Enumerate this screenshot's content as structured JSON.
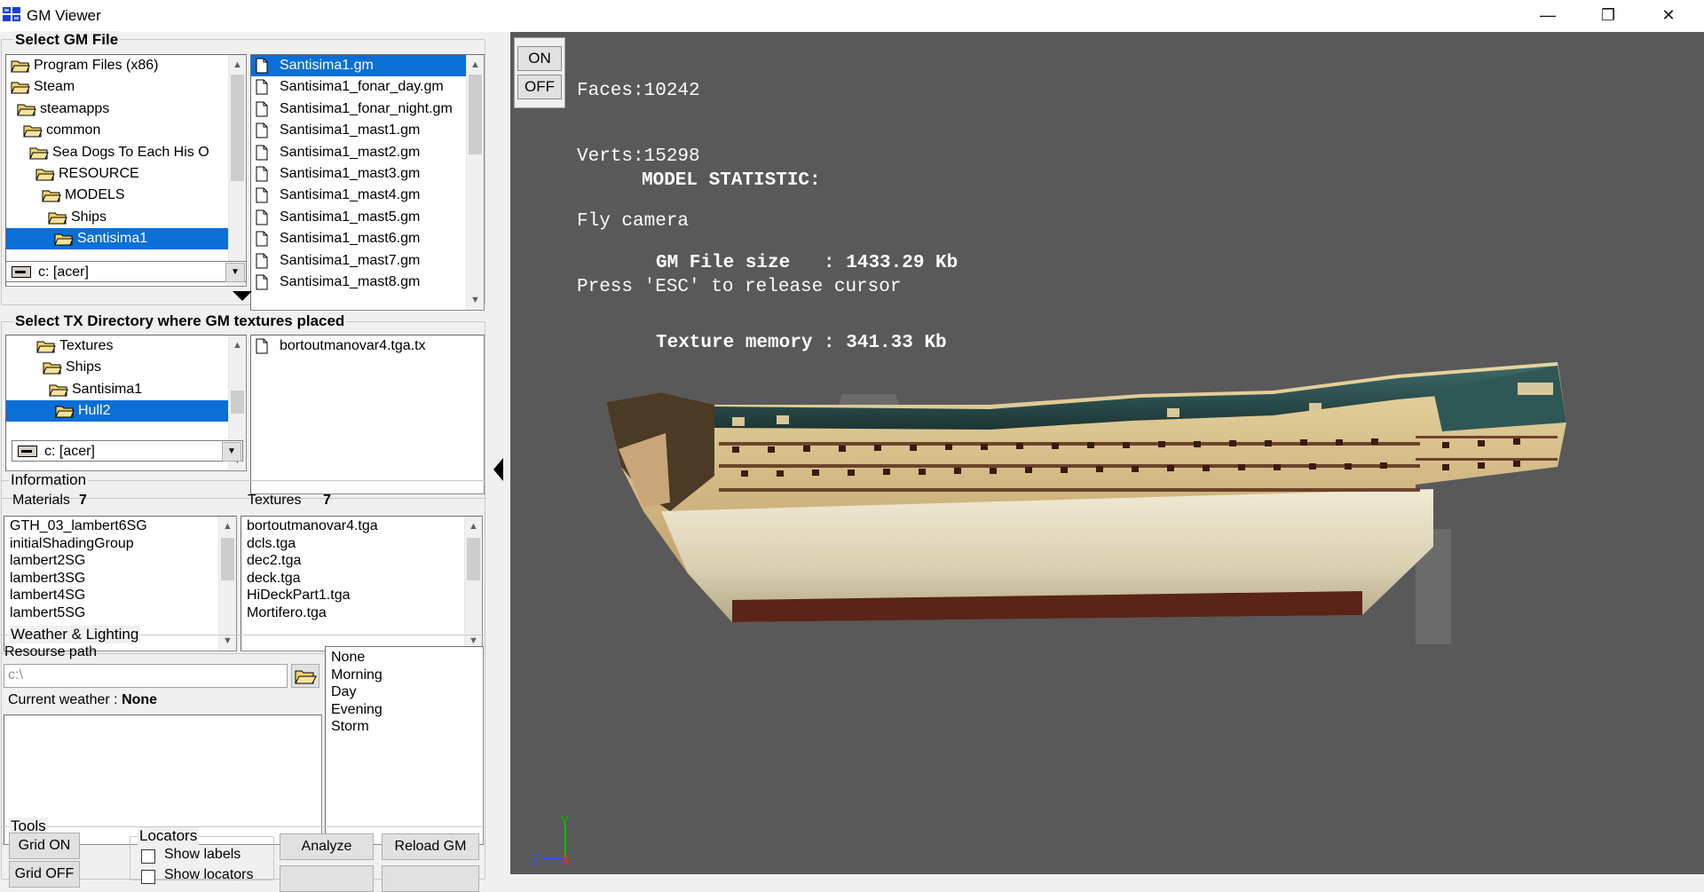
{
  "window": {
    "title": "GM Viewer",
    "buttons": [
      "—",
      "❐",
      "✕"
    ]
  },
  "gm_file": {
    "title": "Select GM File",
    "folders": [
      {
        "label": "Program Files (x86)",
        "depth": 0,
        "selected": false
      },
      {
        "label": "Steam",
        "depth": 0,
        "selected": false
      },
      {
        "label": "steamapps",
        "depth": 1,
        "selected": false
      },
      {
        "label": "common",
        "depth": 2,
        "selected": false
      },
      {
        "label": "Sea Dogs To Each His O",
        "depth": 3,
        "selected": false
      },
      {
        "label": "RESOURCE",
        "depth": 4,
        "selected": false
      },
      {
        "label": "MODELS",
        "depth": 5,
        "selected": false
      },
      {
        "label": "Ships",
        "depth": 6,
        "selected": false
      },
      {
        "label": "Santisima1",
        "depth": 7,
        "selected": true
      }
    ],
    "drive": "c: [acer]",
    "files": [
      {
        "label": "Santisima1.gm",
        "selected": true
      },
      {
        "label": "Santisima1_fonar_day.gm",
        "selected": false
      },
      {
        "label": "Santisima1_fonar_night.gm",
        "selected": false
      },
      {
        "label": "Santisima1_mast1.gm",
        "selected": false
      },
      {
        "label": "Santisima1_mast2.gm",
        "selected": false
      },
      {
        "label": "Santisima1_mast3.gm",
        "selected": false
      },
      {
        "label": "Santisima1_mast4.gm",
        "selected": false
      },
      {
        "label": "Santisima1_mast5.gm",
        "selected": false
      },
      {
        "label": "Santisima1_mast6.gm",
        "selected": false
      },
      {
        "label": "Santisima1_mast7.gm",
        "selected": false
      },
      {
        "label": "Santisima1_mast8.gm",
        "selected": false
      }
    ]
  },
  "tx_dir": {
    "title": "Select TX Directory where GM textures placed",
    "folders": [
      {
        "label": "Textures",
        "depth": 0,
        "selected": false
      },
      {
        "label": "Ships",
        "depth": 1,
        "selected": false
      },
      {
        "label": "Santisima1",
        "depth": 2,
        "selected": false
      },
      {
        "label": "Hull2",
        "depth": 3,
        "selected": true
      }
    ],
    "drive": "c: [acer]",
    "files": [
      "bortoutmanovar4.tga.tx"
    ]
  },
  "info": {
    "title": "Information",
    "materials_label": "Materials",
    "materials_count": "7",
    "textures_label": "Textures",
    "textures_count": "7",
    "materials": [
      "GTH_03_lambert6SG",
      "initialShadingGroup",
      "lambert2SG",
      "lambert3SG",
      "lambert4SG",
      "lambert5SG"
    ],
    "textures": [
      "bortoutmanovar4.tga",
      "dcls.tga",
      "dec2.tga",
      "deck.tga",
      "HiDeckPart1.tga",
      "Mortifero.tga"
    ]
  },
  "weather": {
    "title": "Weather & Lighting",
    "resource_label": "Resourse path",
    "resource_path": "c:\\",
    "current_label": "Current weather :",
    "current_value": "None",
    "options": [
      "None",
      "Morning",
      "Day",
      "Evening",
      "Storm"
    ]
  },
  "tools": {
    "title": "Tools",
    "grid_on": "Grid ON",
    "grid_off": "Grid OFF",
    "locators_title": "Locators",
    "show_labels": "Show labels",
    "show_locators": "Show locators",
    "analyze": "Analyze",
    "reload": "Reload GM"
  },
  "viewport": {
    "on_label": "ON",
    "off_label": "OFF",
    "hud_lines": [
      "Faces:10242",
      "Verts:15298",
      "Fly camera",
      "Press 'ESC' to release cursor"
    ],
    "stats_title": "MODEL STATISTIC:",
    "stats_lines": [
      "GM File size   : 1433.29 Kb",
      "Texture memory : 341.33 Kb"
    ],
    "axis_y": "Y",
    "axis_z": "Z",
    "axis_x": "X",
    "colors": {
      "background": "#595959",
      "axis_y": "#00c000",
      "axis_z": "#3050ff",
      "axis_x": "#ff2020",
      "hull_wood": "#e6dcc2",
      "trim": "#2d4a4a"
    }
  }
}
